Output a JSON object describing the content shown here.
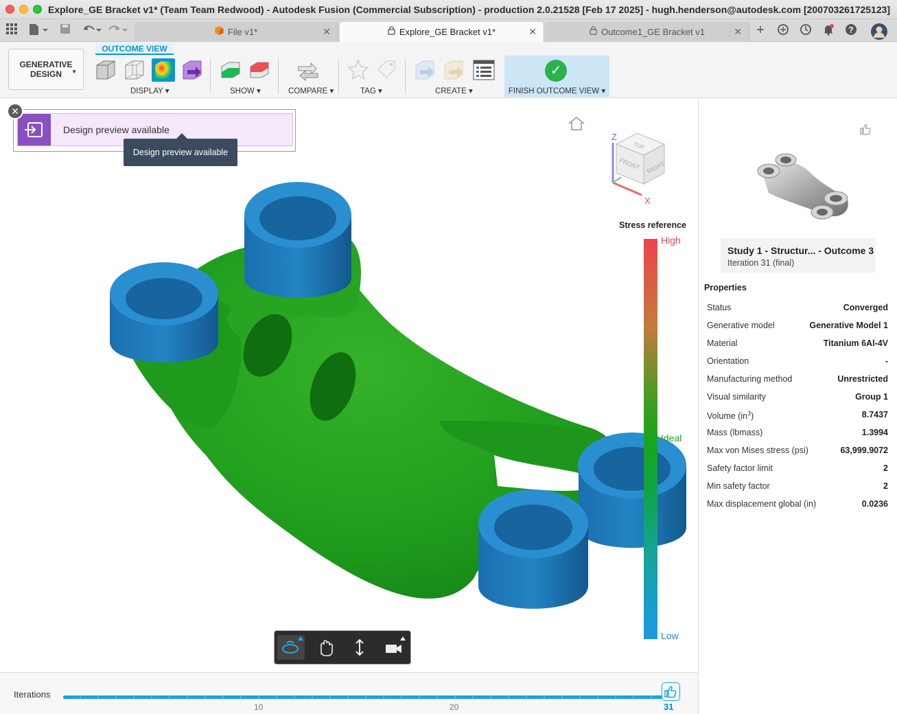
{
  "window": {
    "title": "Explore_GE Bracket v1* (Team Team Redwood) - Autodesk Fusion (Commercial Subscription) - production 2.0.21528 [Feb 17 2025] - hugh.henderson@autodesk.com [200703261725123]"
  },
  "tabs": [
    {
      "label": "File v1*"
    },
    {
      "label": "Explore_GE Bracket v1*"
    },
    {
      "label": "Outcome1_GE Bracket v1"
    }
  ],
  "toolbar": {
    "workspace_line1": "GENERATIVE",
    "workspace_line2": "DESIGN",
    "mode_tab": "OUTCOME VIEW",
    "groups": {
      "display": "DISPLAY",
      "show": "SHOW",
      "compare": "COMPARE",
      "tag": "TAG",
      "create": "CREATE",
      "finish": "FINISH OUTCOME VIEW"
    }
  },
  "notification": {
    "text": "Design preview available",
    "tooltip": "Design preview available"
  },
  "viewcube": {
    "axis_z": "Z",
    "axis_x": "X",
    "face_top": "TOP",
    "face_front": "FRONT",
    "face_right": "RIGHT"
  },
  "stress_legend": {
    "title": "Stress reference",
    "high": "High",
    "ideal": "Ideal",
    "low": "Low",
    "colors": {
      "high": "#f0434d",
      "ideal": "#16a71a",
      "low": "#1a9ae6"
    }
  },
  "iterations": {
    "label": "Iterations",
    "tick_10": "10",
    "tick_20": "20",
    "current": "31",
    "max": 31
  },
  "outcome_card": {
    "title": "Study 1 - Structur... - Outcome 3",
    "subtitle": "Iteration 31 (final)"
  },
  "properties": {
    "heading": "Properties",
    "rows": [
      {
        "name": "Status",
        "value": "Converged"
      },
      {
        "name": "Generative model",
        "value": "Generative Model 1"
      },
      {
        "name": "Material",
        "value": "Titanium 6Al-4V"
      },
      {
        "name": "Orientation",
        "value": "-"
      },
      {
        "name": "Manufacturing method",
        "value": "Unrestricted"
      },
      {
        "name": "Visual similarity",
        "value": "Group 1"
      },
      {
        "name": "Volume (in",
        "name_sup": "3",
        "name_after": ")",
        "value": "8.7437"
      },
      {
        "name": "Mass (lbmass)",
        "value": "1.3994"
      },
      {
        "name": "Max von Mises stress (psi)",
        "value": "63,999.9072"
      },
      {
        "name": "Safety factor limit",
        "value": "2"
      },
      {
        "name": "Min safety factor",
        "value": "2"
      },
      {
        "name": "Max displacement global (in)",
        "value": "0.0236"
      }
    ]
  }
}
